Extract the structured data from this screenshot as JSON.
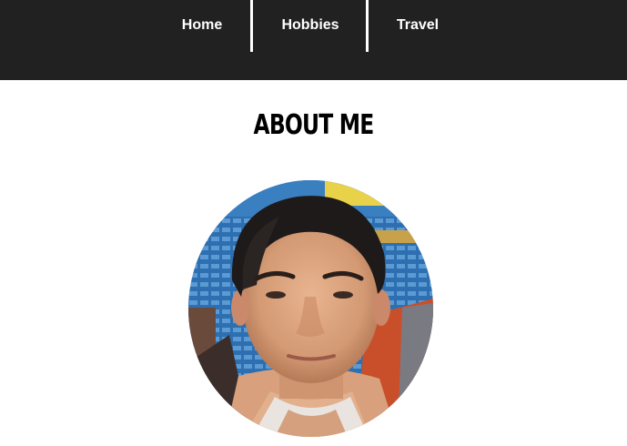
{
  "nav": {
    "items": [
      {
        "label": "Home"
      },
      {
        "label": "Hobbies"
      },
      {
        "label": "Travel"
      }
    ]
  },
  "main": {
    "title": "ABOUT ME"
  },
  "colors": {
    "nav_bg": "#212121",
    "nav_text": "#ffffff",
    "page_bg": "#ffffff",
    "title": "#000000"
  },
  "avatar": {
    "shape": "circle"
  }
}
